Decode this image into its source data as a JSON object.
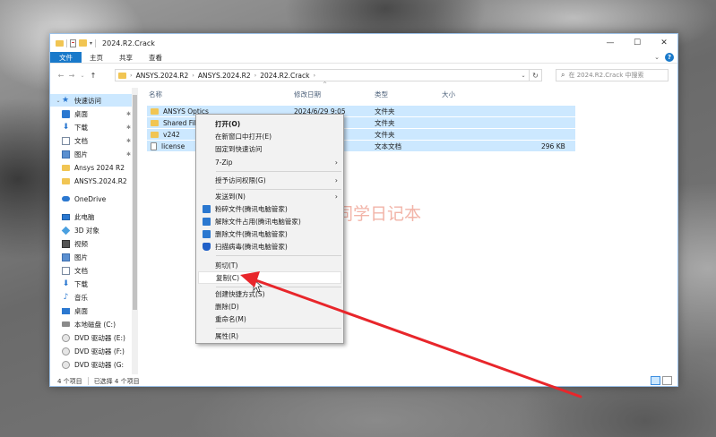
{
  "window": {
    "title": "2024.R2.Crack",
    "controls": {
      "minimize": "—",
      "maximize": "☐",
      "close": "✕"
    }
  },
  "ribbon": {
    "tabs": [
      "文件",
      "主页",
      "共享",
      "查看"
    ],
    "expand": "⌄",
    "help": "?"
  },
  "nav": {
    "back": "←",
    "forward": "→",
    "recent": "⌄",
    "up": "↑"
  },
  "address": {
    "root_sep": "›",
    "crumbs": [
      "ANSYS.2024.R2",
      "ANSYS.2024.R2",
      "2024.R2.Crack"
    ],
    "dropdown": "⌄",
    "refresh": "↻"
  },
  "search": {
    "placeholder": "在 2024.R2.Crack 中搜索",
    "icon": "⌕"
  },
  "sidebar": {
    "items": [
      {
        "label": "快速访问",
        "icon": "star-icon",
        "expand": "⌄"
      },
      {
        "label": "桌面",
        "icon": "desktop-icon",
        "pin": "📌"
      },
      {
        "label": "下载",
        "icon": "download-icon",
        "pin": "📌"
      },
      {
        "label": "文档",
        "icon": "document-icon",
        "pin": "📌"
      },
      {
        "label": "图片",
        "icon": "picture-icon",
        "pin": "📌"
      },
      {
        "label": "Ansys 2024 R2",
        "icon": "folder-icon"
      },
      {
        "label": "ANSYS.2024.R2",
        "icon": "folder-icon"
      },
      {
        "label": "OneDrive",
        "icon": "cloud-icon",
        "expand": "›"
      },
      {
        "label": "此电脑",
        "icon": "pc-icon",
        "expand": "⌄"
      },
      {
        "label": "3D 对象",
        "icon": "3d-objects-icon",
        "expand": "›"
      },
      {
        "label": "视频",
        "icon": "video-icon",
        "expand": "›"
      },
      {
        "label": "图片",
        "icon": "picture-icon",
        "expand": "›"
      },
      {
        "label": "文档",
        "icon": "document-icon",
        "expand": "›"
      },
      {
        "label": "下载",
        "icon": "download-icon",
        "expand": "›"
      },
      {
        "label": "音乐",
        "icon": "music-icon",
        "expand": "›"
      },
      {
        "label": "桌面",
        "icon": "desktop-icon",
        "expand": "›"
      },
      {
        "label": "本地磁盘 (C:)",
        "icon": "drive-icon",
        "expand": "›"
      },
      {
        "label": "DVD 驱动器 (E:)",
        "icon": "dvd-icon",
        "expand": "›"
      },
      {
        "label": "DVD 驱动器 (F:)",
        "icon": "dvd-icon",
        "expand": "›"
      },
      {
        "label": "DVD 驱动器 (G:",
        "icon": "dvd-icon",
        "expand": "›"
      }
    ]
  },
  "filelist": {
    "columns": [
      "名称",
      "修改日期",
      "类型",
      "大小"
    ],
    "sort_indicator": "^",
    "rows": [
      {
        "name": "ANSYS Optics",
        "date": "2024/6/29 9:05",
        "type": "文件夹",
        "size": ""
      },
      {
        "name": "Shared File",
        "date": "",
        "type": "文件夹",
        "size": ""
      },
      {
        "name": "v242",
        "date": "",
        "type": "文件夹",
        "size": ""
      },
      {
        "name": "license",
        "date": "",
        "type": "文本文档",
        "size": "296 KB"
      }
    ]
  },
  "status": {
    "count": "4 个项目",
    "selected": "已选择 4 个项目"
  },
  "context_menu": {
    "items": [
      {
        "label": "打开(O)"
      },
      {
        "label": "在新窗口中打开(E)"
      },
      {
        "label": "固定到快速访问"
      },
      {
        "label": "7-Zip",
        "submenu": "›"
      },
      {
        "label": "授予访问权限(G)",
        "submenu": "›"
      },
      {
        "label": "发送到(N)",
        "submenu": "›"
      },
      {
        "label": "粉碎文件(腾讯电脑管家)"
      },
      {
        "label": "解除文件占用(腾讯电脑管家)"
      },
      {
        "label": "删除文件(腾讯电脑管家)"
      },
      {
        "label": "扫描病毒(腾讯电脑管家)"
      },
      {
        "label": "剪切(T)"
      },
      {
        "label": "复制(C)"
      },
      {
        "label": "创建快捷方式(S)"
      },
      {
        "label": "删除(D)"
      },
      {
        "label": "重命名(M)"
      },
      {
        "label": "属性(R)"
      }
    ]
  },
  "watermark": {
    "text": "丁同学日记本"
  },
  "colors": {
    "accent": "#1979ca",
    "selection": "#cce8ff",
    "arrow": "#e8262b"
  }
}
